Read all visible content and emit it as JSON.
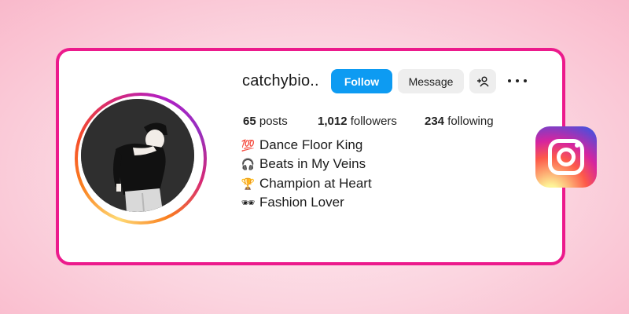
{
  "profile": {
    "username": "catchybio..",
    "stats": {
      "posts_count": "65",
      "posts_label": "posts",
      "followers_count": "1,012",
      "followers_label": "followers",
      "following_count": "234",
      "following_label": "following"
    },
    "bio": [
      {
        "emoji": "💯",
        "text": "Dance Floor King"
      },
      {
        "emoji": "🎧",
        "text": "Beats in My Veins"
      },
      {
        "emoji": "🏆",
        "text": "Champion at Heart"
      },
      {
        "emoji": "🕶",
        "text": "Fashion Lover"
      }
    ]
  },
  "actions": {
    "follow_label": "Follow",
    "message_label": "Message",
    "add_user_icon": "add-user-icon",
    "more_icon": "more-options-icon"
  },
  "colors": {
    "card_border": "#ec1a8c",
    "follow_button": "#0d9bf2",
    "secondary_button": "#eeeeee"
  },
  "brand": {
    "logo": "instagram-logo"
  }
}
